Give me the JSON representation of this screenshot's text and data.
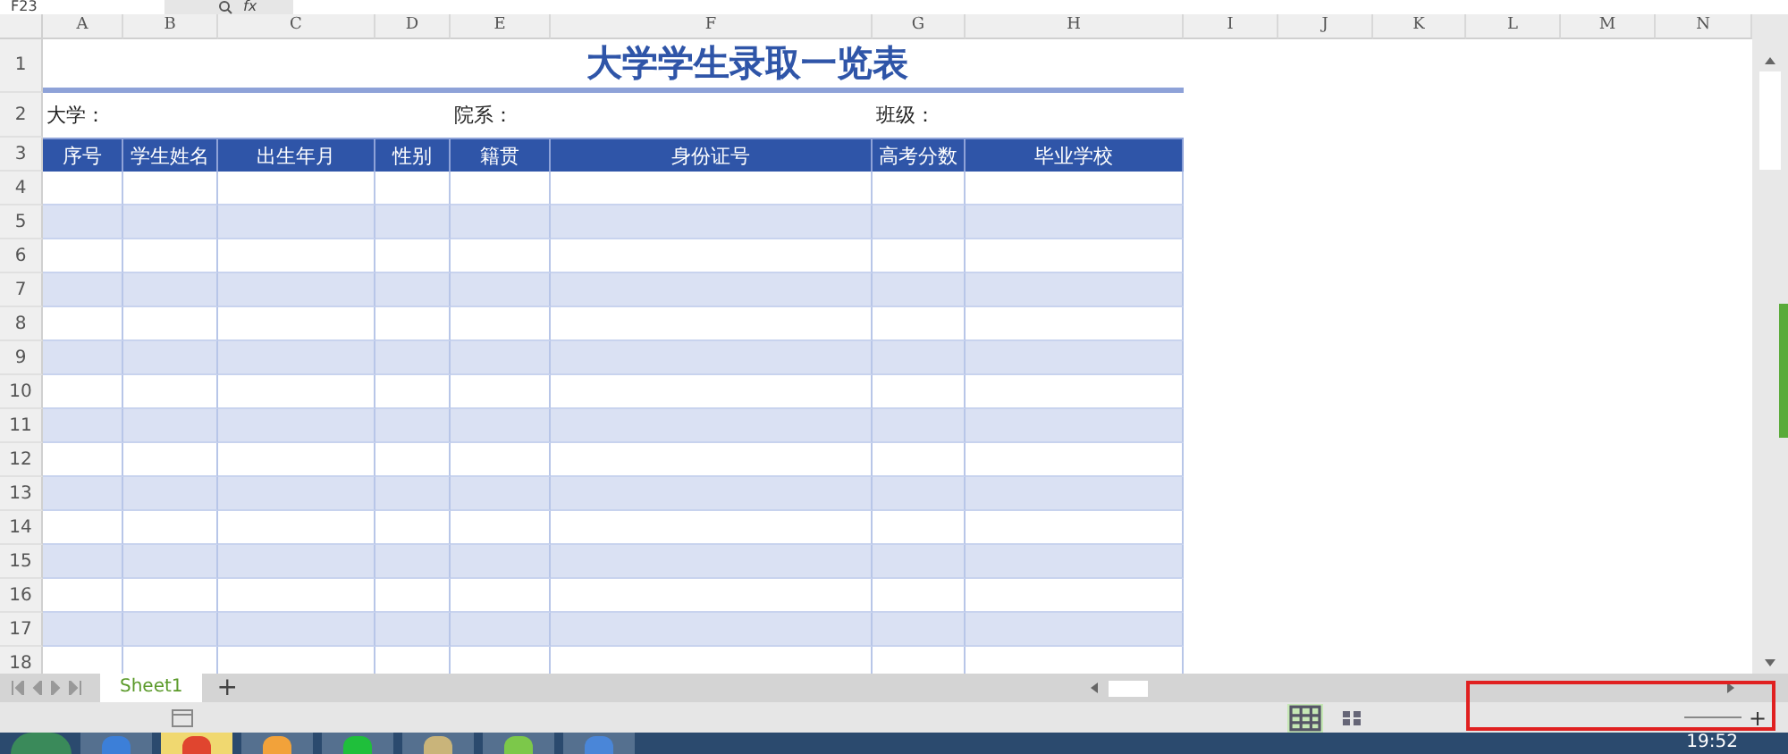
{
  "formula_bar": {
    "name_box": "F23",
    "function_label": "fx"
  },
  "columns": [
    "A",
    "B",
    "C",
    "D",
    "E",
    "F",
    "G",
    "H",
    "I",
    "J",
    "K",
    "L",
    "M",
    "N"
  ],
  "row_headers": [
    "1",
    "2",
    "3",
    "4",
    "5",
    "6",
    "7",
    "8",
    "9",
    "10",
    "11",
    "12",
    "13",
    "14",
    "15",
    "16",
    "17",
    "18"
  ],
  "sheet": {
    "title": "大学学生录取一览表",
    "info": [
      {
        "label": "大学："
      },
      {
        "label": "院系："
      },
      {
        "label": "班级："
      }
    ],
    "headers": [
      "序号",
      "学生姓名",
      "出生年月",
      "性别",
      "籍贯",
      "身份证号",
      "高考分数",
      "毕业学校"
    ],
    "body_rows": [
      {
        "shaded": false
      },
      {
        "shaded": true
      },
      {
        "shaded": false
      },
      {
        "shaded": true
      },
      {
        "shaded": false
      },
      {
        "shaded": true
      },
      {
        "shaded": false
      },
      {
        "shaded": true
      },
      {
        "shaded": false
      },
      {
        "shaded": true
      },
      {
        "shaded": false
      },
      {
        "shaded": true
      },
      {
        "shaded": false
      },
      {
        "shaded": true
      },
      {
        "shaded": false
      }
    ]
  },
  "sheet_tabs": [
    {
      "label": "Sheet1",
      "selected": true
    }
  ],
  "add_sheet": "+",
  "zoom_in": "+",
  "taskbar": {
    "clock": "19:52"
  }
}
